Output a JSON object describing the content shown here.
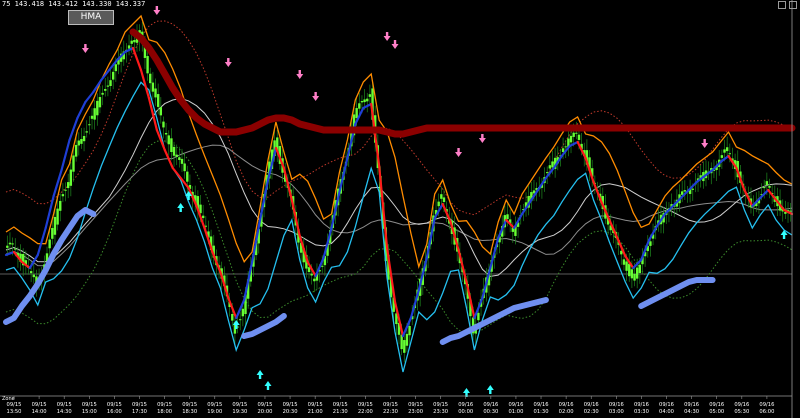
{
  "header": {
    "ohlc_text": "75  143.418 143.412 143.330 143.337",
    "indicator_button_label": "HMA"
  },
  "axis": {
    "zone_label": "Zone"
  },
  "colors": {
    "background": "#000000",
    "candle_body": "#66ff33",
    "candle_wick": "#1f8a1f",
    "hull_up": "#1f3fd6",
    "hull_down": "#ff1a1a",
    "upper_band_thick": "#8b0000",
    "lower_band_thick": "#6f8ff0",
    "orange_line": "#ff8c00",
    "light_blue_line": "#25c0f0",
    "white_line": "#cfcfcf",
    "gray_line": "#8c8c8c",
    "dotted_red": "#c0392b",
    "dotted_green": "#3c8c2c",
    "arrow_up": "#33ffff",
    "arrow_down": "#ff7fc8",
    "crosshair": "#7a7a7a"
  },
  "chart_data": {
    "type": "candlestick",
    "title": "",
    "xlabel": "",
    "ylabel": "",
    "x_ticks": [
      {
        "top": "09/15",
        "bottom": "13:50"
      },
      {
        "top": "09/15",
        "bottom": "14:00"
      },
      {
        "top": "09/15",
        "bottom": "14:30"
      },
      {
        "top": "09/15",
        "bottom": "15:00"
      },
      {
        "top": "09/15",
        "bottom": "16:00"
      },
      {
        "top": "09/15",
        "bottom": "17:30"
      },
      {
        "top": "09/15",
        "bottom": "18:00"
      },
      {
        "top": "09/15",
        "bottom": "18:30"
      },
      {
        "top": "09/15",
        "bottom": "19:00"
      },
      {
        "top": "09/15",
        "bottom": "19:30"
      },
      {
        "top": "09/15",
        "bottom": "20:00"
      },
      {
        "top": "09/15",
        "bottom": "20:30"
      },
      {
        "top": "09/15",
        "bottom": "21:00"
      },
      {
        "top": "09/15",
        "bottom": "21:30"
      },
      {
        "top": "09/15",
        "bottom": "22:00"
      },
      {
        "top": "09/15",
        "bottom": "22:30"
      },
      {
        "top": "09/15",
        "bottom": "23:00"
      },
      {
        "top": "09/15",
        "bottom": "23:30"
      },
      {
        "top": "09/16",
        "bottom": "00:00"
      },
      {
        "top": "09/16",
        "bottom": "00:30"
      },
      {
        "top": "09/16",
        "bottom": "01:00"
      },
      {
        "top": "09/16",
        "bottom": "01:30"
      },
      {
        "top": "09/16",
        "bottom": "02:00"
      },
      {
        "top": "09/16",
        "bottom": "02:30"
      },
      {
        "top": "09/16",
        "bottom": "03:00"
      },
      {
        "top": "09/16",
        "bottom": "03:30"
      },
      {
        "top": "09/16",
        "bottom": "04:00"
      },
      {
        "top": "09/16",
        "bottom": "04:30"
      },
      {
        "top": "09/16",
        "bottom": "05:00"
      },
      {
        "top": "09/16",
        "bottom": "05:30"
      },
      {
        "top": "09/16",
        "bottom": "06:00"
      }
    ],
    "price_path": [
      250,
      245,
      258,
      270,
      285,
      262,
      232,
      198,
      182,
      148,
      132,
      118,
      98,
      82,
      68,
      50,
      42,
      34,
      70,
      98,
      130,
      148,
      160,
      182,
      200,
      222,
      248,
      268,
      300,
      330,
      310,
      270,
      225,
      178,
      140,
      170,
      200,
      240,
      268,
      282,
      262,
      232,
      190,
      158,
      118,
      100,
      92,
      172,
      258,
      312,
      352,
      322,
      292,
      262,
      212,
      198,
      222,
      250,
      288,
      330,
      300,
      272,
      240,
      218,
      232,
      212,
      200,
      188,
      176,
      165,
      152,
      140,
      135,
      152,
      180,
      200,
      222,
      242,
      262,
      278,
      268,
      242,
      228,
      214,
      205,
      198,
      190,
      182,
      176,
      170,
      160,
      150,
      165,
      190,
      208,
      195,
      185,
      200,
      210,
      215
    ],
    "hull_ma": [
      255,
      252,
      262,
      268,
      255,
      228,
      196,
      170,
      140,
      118,
      102,
      92,
      80,
      70,
      60,
      52,
      48,
      70,
      98,
      130,
      150,
      168,
      178,
      188,
      206,
      228,
      252,
      272,
      298,
      318,
      300,
      262,
      220,
      180,
      148,
      168,
      200,
      236,
      262,
      276,
      258,
      228,
      192,
      158,
      124,
      108,
      104,
      166,
      248,
      302,
      336,
      318,
      290,
      258,
      218,
      204,
      222,
      250,
      282,
      318,
      298,
      268,
      238,
      220,
      228,
      214,
      202,
      190,
      178,
      168,
      156,
      146,
      142,
      158,
      182,
      202,
      220,
      238,
      256,
      268,
      260,
      240,
      226,
      214,
      206,
      198,
      190,
      182,
      176,
      170,
      162,
      156,
      168,
      190,
      206,
      198,
      190,
      200,
      210,
      214
    ],
    "upper_band_thick": [
      null,
      null,
      null,
      null,
      null,
      null,
      null,
      null,
      null,
      null,
      null,
      null,
      null,
      null,
      null,
      null,
      32,
      38,
      48,
      60,
      74,
      88,
      100,
      110,
      118,
      124,
      128,
      132,
      132,
      132,
      130,
      128,
      124,
      120,
      118,
      118,
      120,
      124,
      126,
      128,
      130,
      130,
      130,
      130,
      130,
      130,
      130,
      130,
      132,
      134,
      134,
      132,
      130,
      128,
      128,
      128,
      128,
      128,
      128,
      128,
      128,
      128,
      128,
      128,
      128,
      128,
      128,
      128,
      128,
      128,
      128,
      128,
      128,
      128,
      128,
      128,
      128,
      128,
      128,
      128,
      128,
      128,
      128,
      128,
      128,
      128,
      128,
      128,
      128,
      128,
      128,
      128,
      128,
      128,
      128,
      128,
      128,
      128,
      128,
      128
    ],
    "lower_band_thick": [
      322,
      318,
      306,
      296,
      284,
      270,
      254,
      240,
      228,
      216,
      210,
      214,
      null,
      null,
      null,
      null,
      null,
      null,
      null,
      null,
      null,
      null,
      null,
      null,
      null,
      null,
      null,
      null,
      null,
      null,
      336,
      334,
      330,
      326,
      322,
      316,
      null,
      null,
      null,
      null,
      null,
      null,
      null,
      null,
      null,
      null,
      null,
      null,
      null,
      null,
      null,
      null,
      null,
      null,
      null,
      342,
      338,
      336,
      332,
      328,
      324,
      320,
      316,
      312,
      308,
      306,
      304,
      302,
      300,
      null,
      null,
      null,
      null,
      null,
      null,
      null,
      null,
      null,
      null,
      null,
      306,
      302,
      298,
      294,
      290,
      286,
      282,
      280,
      280,
      280,
      null,
      null,
      null,
      null,
      null,
      null,
      null,
      null,
      null,
      null
    ],
    "arrows_up": [
      {
        "i": 22,
        "v": 208
      },
      {
        "i": 23,
        "v": 196
      },
      {
        "i": 29,
        "v": 325
      },
      {
        "i": 32,
        "v": 375
      },
      {
        "i": 33,
        "v": 386
      },
      {
        "i": 58,
        "v": 393
      },
      {
        "i": 61,
        "v": 390
      },
      {
        "i": 98,
        "v": 235
      }
    ],
    "arrows_down": [
      {
        "i": 10,
        "v": 48
      },
      {
        "i": 19,
        "v": 10
      },
      {
        "i": 28,
        "v": 62
      },
      {
        "i": 37,
        "v": 74
      },
      {
        "i": 39,
        "v": 96
      },
      {
        "i": 48,
        "v": 36
      },
      {
        "i": 49,
        "v": 44
      },
      {
        "i": 57,
        "v": 152
      },
      {
        "i": 60,
        "v": 138
      },
      {
        "i": 88,
        "v": 143
      }
    ],
    "horizontal_line_value": 274
  }
}
